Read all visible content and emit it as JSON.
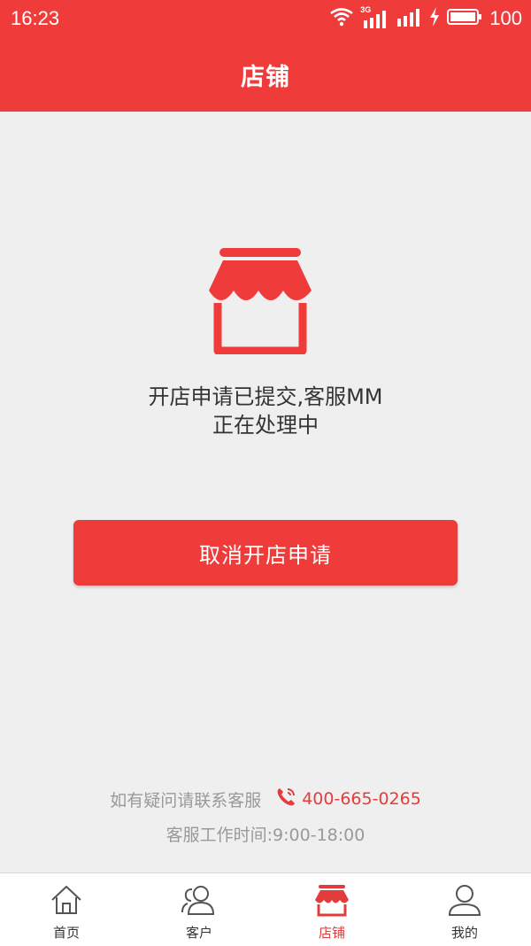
{
  "status_bar": {
    "time": "16:23",
    "network_label": "3G",
    "battery": "100"
  },
  "header": {
    "title": "店铺"
  },
  "main": {
    "message_line1": "开店申请已提交,客服MM",
    "message_line2": "正在处理中",
    "cancel_button_label": "取消开店申请"
  },
  "contact": {
    "prompt": "如有疑问请联系客服",
    "phone": "400-665-0265",
    "hours": "客服工作时间:9:00-18:00"
  },
  "tabs": [
    {
      "label": "首页",
      "icon": "home-icon"
    },
    {
      "label": "客户",
      "icon": "customers-icon"
    },
    {
      "label": "店铺",
      "icon": "shop-icon"
    },
    {
      "label": "我的",
      "icon": "profile-icon"
    }
  ],
  "active_tab": "店铺",
  "colors": {
    "accent": "#f03b3b",
    "background": "#efefef",
    "muted_text": "#999999"
  }
}
